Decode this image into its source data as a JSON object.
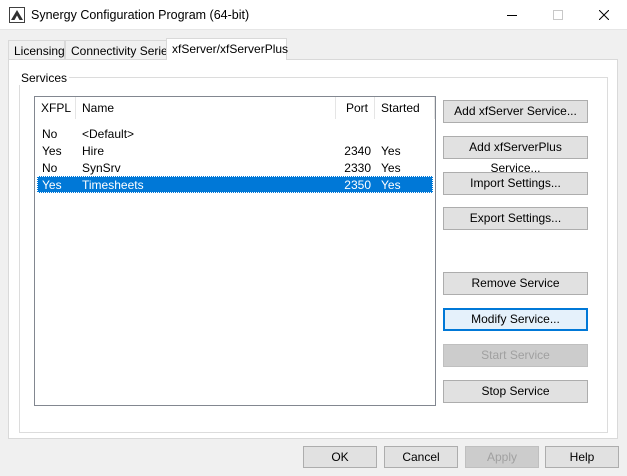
{
  "window": {
    "title": "Synergy Configuration Program (64-bit)"
  },
  "tabs": [
    {
      "label": "Licensing",
      "active": false
    },
    {
      "label": "Connectivity Series",
      "active": false
    },
    {
      "label": "xfServer/xfServerPlus",
      "active": true
    }
  ],
  "services": {
    "group_label": "Services",
    "columns": [
      "XFPL",
      "Name",
      "Port",
      "Started"
    ],
    "rows": [
      {
        "xfpl": "No",
        "name": "<Default>",
        "port": "",
        "started": "",
        "selected": false
      },
      {
        "xfpl": "Yes",
        "name": "Hire",
        "port": "2340",
        "started": "Yes",
        "selected": false
      },
      {
        "xfpl": "No",
        "name": "SynSrv",
        "port": "2330",
        "started": "Yes",
        "selected": false
      },
      {
        "xfpl": "Yes",
        "name": "Timesheets",
        "port": "2350",
        "started": "Yes",
        "selected": true
      }
    ]
  },
  "actions": {
    "add_xfserver": "Add xfServer Service...",
    "add_xfserverplus": "Add xfServerPlus Service...",
    "import_settings": "Import Settings...",
    "export_settings": "Export Settings...",
    "remove_service": "Remove Service",
    "modify_service": "Modify Service...",
    "start_service": "Start Service",
    "stop_service": "Stop Service"
  },
  "footer": {
    "ok": "OK",
    "cancel": "Cancel",
    "apply": "Apply",
    "help": "Help"
  },
  "colors": {
    "selection": "#0078d7",
    "focus_border": "#0078d7"
  }
}
